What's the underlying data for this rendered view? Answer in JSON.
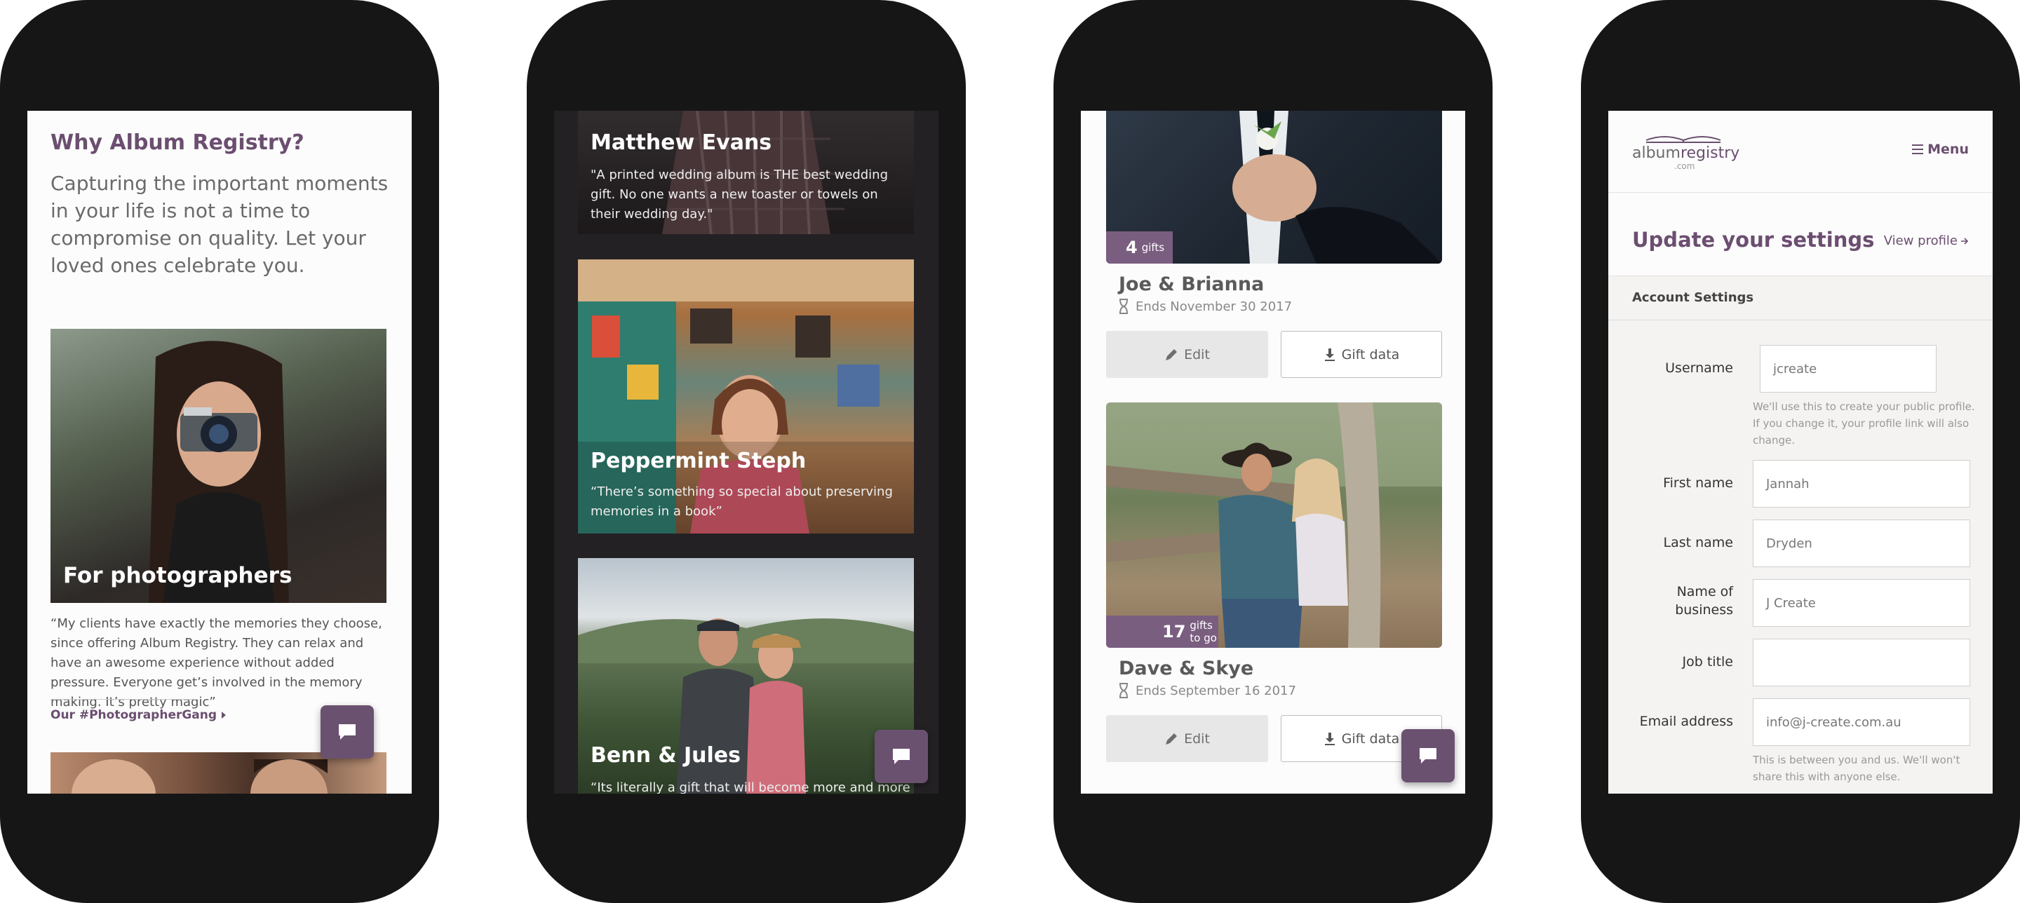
{
  "phone1": {
    "heading": "Why Album Registry?",
    "intro": "Capturing the important moments in your life is not a time to compromise on quality. Let your loved ones celebrate you.",
    "card_title": "For photographers",
    "quote": "“My clients have exactly the memories they choose, since offering Album Registry. They can relax and have an awesome experience without added pressure. Everyone get’s involved in the memory making. It’s pretty magic”",
    "link_label": "Our #PhotographerGang"
  },
  "phone2": {
    "testimonials": [
      {
        "name": "Matthew Evans",
        "quote": "\"A printed wedding album is THE best wedding gift. No one wants a new toaster or towels on their wedding day.\""
      },
      {
        "name": "Peppermint Steph",
        "quote": "“There’s something so special about preserving memories in a book”"
      },
      {
        "name": "Benn & Jules",
        "quote": "“Its literally a gift that will become more and more"
      }
    ]
  },
  "phone3": {
    "registries": [
      {
        "gift_count": "4",
        "gift_label": "gifts",
        "couple": "Joe & Brianna",
        "ends": "Ends November 30 2017"
      },
      {
        "gift_count": "17",
        "gift_label": "gifts to go",
        "couple": "Dave & Skye",
        "ends": "Ends September 16 2017"
      }
    ],
    "edit_label": "Edit",
    "gift_data_label": "Gift data"
  },
  "phone4": {
    "logo_text_album": "album",
    "logo_text_registry": "registry",
    "logo_suffix": ".com",
    "menu_label": "Menu",
    "page_title": "Update your settings",
    "view_profile": "View profile",
    "section_label": "Account Settings",
    "fields": {
      "username": {
        "label": "Username",
        "value": "jcreate"
      },
      "username_help": "We'll use this to create your public profile. If you change it, your profile link will also change.",
      "first_name": {
        "label": "First name",
        "value": "Jannah"
      },
      "last_name": {
        "label": "Last name",
        "value": "Dryden"
      },
      "business": {
        "label": "Name of business",
        "value": "J Create"
      },
      "job_title": {
        "label": "Job title",
        "value": ""
      },
      "email": {
        "label": "Email address",
        "value": "info@j-create.com.au"
      },
      "email_help": "This is between you and us. We'll won't share this with anyone else."
    }
  },
  "colors": {
    "accent": "#6b4e70",
    "phone_frame": "#171617"
  },
  "icons": [
    "chat-icon",
    "pencil-icon",
    "download-icon",
    "hourglass-icon",
    "menu-icon",
    "arrow-right-icon",
    "caret-right-icon",
    "open-book-icon"
  ]
}
